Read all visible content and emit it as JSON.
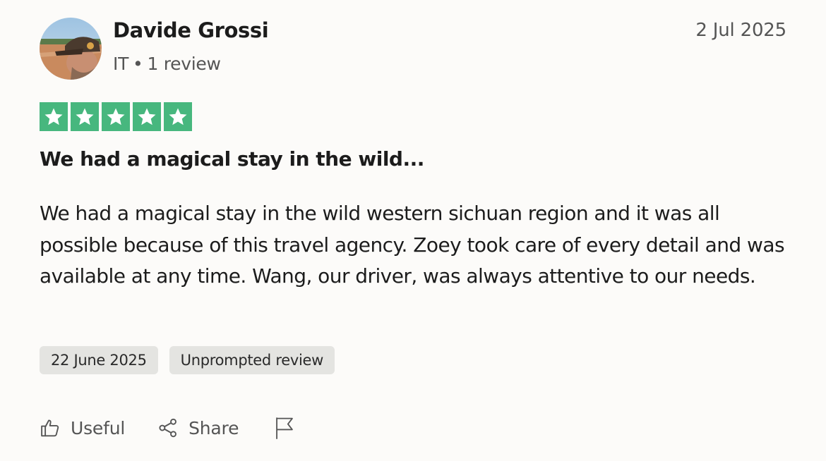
{
  "reviewer": {
    "name": "Davide Grossi",
    "country": "IT",
    "separator": "•",
    "review_count": "1 review",
    "avatar_icon": "user-avatar-photo"
  },
  "review": {
    "posted_date": "2 Jul 2025",
    "rating": 5,
    "rating_max": 5,
    "star_color": "#47b77e",
    "title": "We had a magical stay in the wild...",
    "body": "We had a magical stay in the wild western sichuan region and it was all possible because of this travel agency. Zoey took care of every detail and was available at any time. Wang, our driver, was always attentive to our needs.",
    "tags": [
      {
        "label": "22 June 2025"
      },
      {
        "label": "Unprompted review"
      }
    ]
  },
  "actions": {
    "useful_label": "Useful",
    "useful_icon": "thumbs-up-icon",
    "share_label": "Share",
    "share_icon": "share-icon",
    "flag_icon": "flag-icon"
  }
}
